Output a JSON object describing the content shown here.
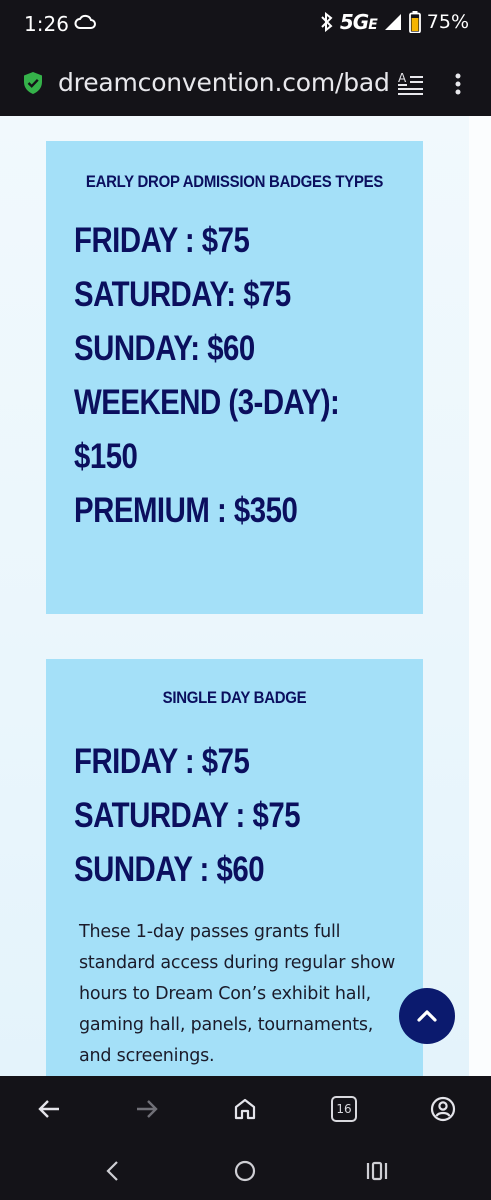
{
  "status_bar": {
    "time": "1:26",
    "network_label": "5G",
    "network_sub": "E",
    "battery": "75%",
    "icons": [
      "cloud-icon",
      "bluetooth-icon",
      "signal-icon",
      "battery-icon"
    ]
  },
  "browser": {
    "url": "dreamconvention.com/badg",
    "tab_count": "16"
  },
  "cards": [
    {
      "heading": "EARLY DROP ADMISSION BADGES TYPES",
      "lines": [
        "FRIDAY : $75",
        "SATURDAY: $75",
        "SUNDAY: $60",
        "WEEKEND (3-DAY):",
        "$150",
        "PREMIUM : $350"
      ]
    },
    {
      "heading": "SINGLE DAY BADGE",
      "lines": [
        "FRIDAY : $75",
        "SATURDAY : $75",
        "SUNDAY : $60"
      ],
      "description": "These 1-day passes grants full standard access during regular show hours to Dream Con’s exhibit hall, gaming hall, panels, tournaments, and screenings."
    }
  ],
  "colors": {
    "card_background": "#a4e0f8",
    "card_text": "#0b0f5e",
    "scroll_button": "#0b1a6e",
    "chrome_background": "#141318"
  }
}
